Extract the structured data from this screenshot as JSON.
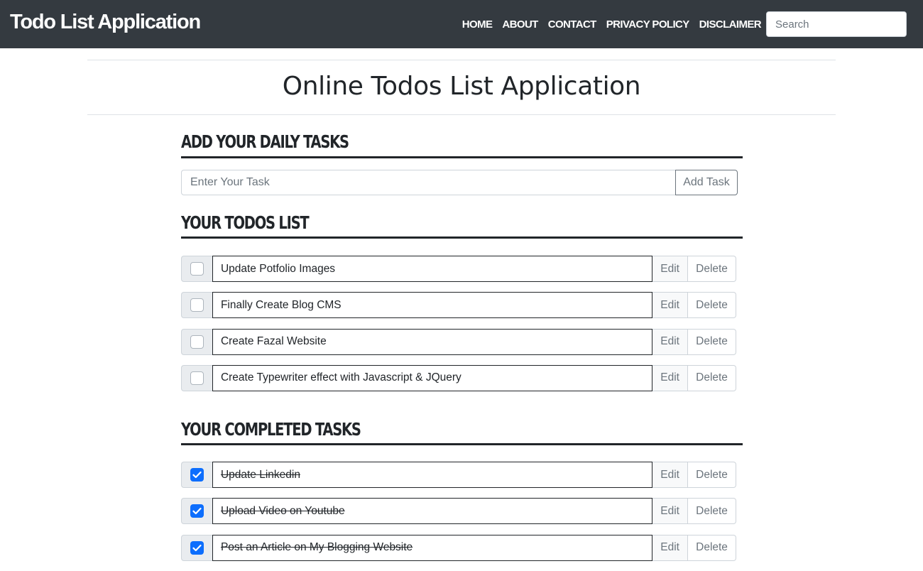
{
  "navbar": {
    "brand": "Todo List Application",
    "links": [
      "HOME",
      "ABOUT",
      "CONTACT",
      "PRIVACY POLICY",
      "DISCLAIMER"
    ],
    "search_placeholder": "Search"
  },
  "page": {
    "title": "Online Todos List Application"
  },
  "add_section": {
    "heading": "ADD YOUR DAILY TASKS",
    "input_placeholder": "Enter Your Task",
    "input_value": "",
    "add_button": "Add Task"
  },
  "todos_section": {
    "heading": "YOUR TODOS LIST",
    "items": [
      {
        "text": "Update Potfolio Images",
        "checked": false
      },
      {
        "text": "Finally Create Blog CMS",
        "checked": false
      },
      {
        "text": "Create Fazal Website",
        "checked": false
      },
      {
        "text": "Create Typewriter effect with Javascript & JQuery",
        "checked": false
      }
    ]
  },
  "completed_section": {
    "heading": "YOUR COMPLETED TASKS",
    "items": [
      {
        "text": "Update Linkedin",
        "checked": true
      },
      {
        "text": "Upload Video on Youtube",
        "checked": true
      },
      {
        "text": "Post an Article on My Blogging Website",
        "checked": true
      }
    ]
  },
  "row_actions": {
    "edit_label": "Edit",
    "delete_label": "Delete"
  },
  "colors": {
    "navbar_bg": "#343a40",
    "checkbox_checked": "#0d6efd",
    "section_underline": "#212529"
  },
  "icons": {
    "checkmark": "check-icon"
  }
}
